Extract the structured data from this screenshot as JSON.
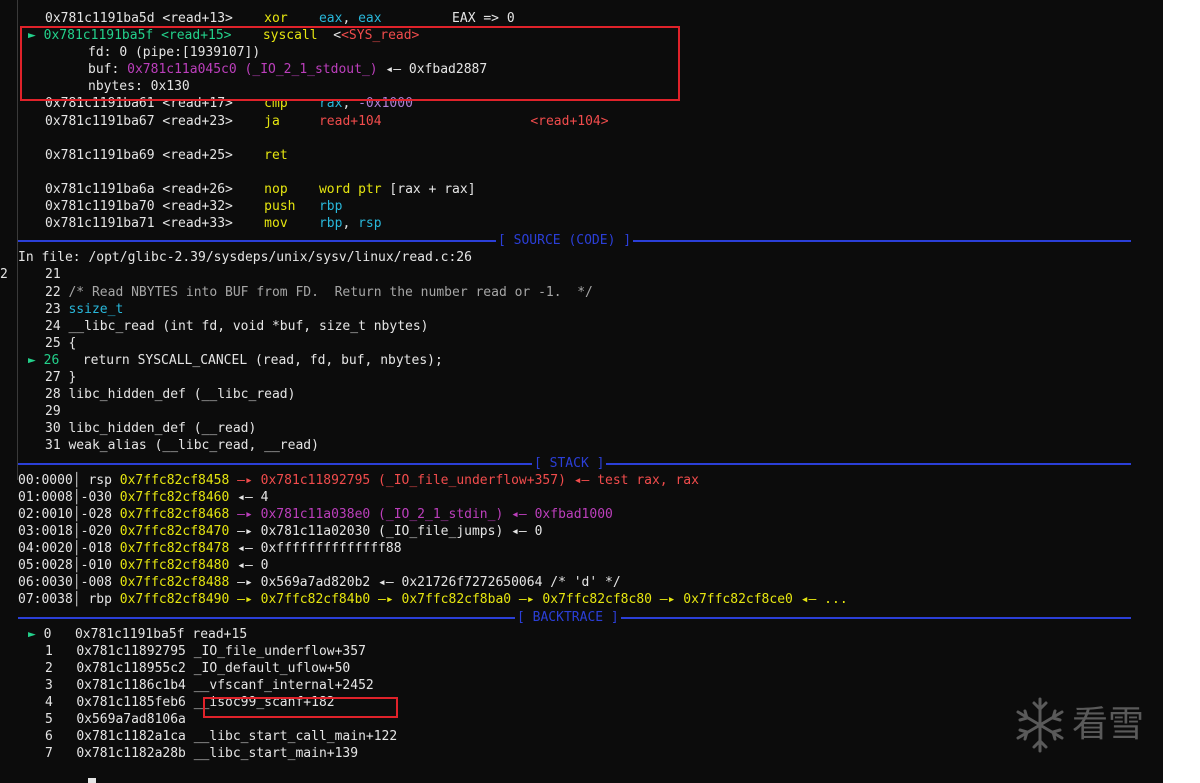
{
  "disasm": [
    {
      "addr": "0x781c1191ba5d",
      "off": "<read+13>",
      "mn": "xor",
      "op1": "eax",
      "sep": ", ",
      "op2": "eax",
      "cmt": "EAX => 0"
    },
    {
      "marker": "►",
      "addr": "0x781c1191ba5f",
      "off": "<read+15>",
      "mn": "syscall",
      "target": "<SYS_read>"
    },
    {
      "addr": "0x781c1191ba61",
      "off": "<read+17>",
      "mn": "cmp",
      "op1": "rax",
      "sep": ", ",
      "op2": "-0x1000"
    },
    {
      "addr": "0x781c1191ba67",
      "off": "<read+23>",
      "mn": "ja",
      "op1": "read+104",
      "cmt": "<read+104>"
    },
    {
      "addr": "0x781c1191ba69",
      "off": "<read+25>",
      "mn": "ret"
    },
    {
      "addr": "0x781c1191ba6a",
      "off": "<read+26>",
      "mn": "nop",
      "op1": "word ptr",
      "op2": "[rax + rax]"
    },
    {
      "addr": "0x781c1191ba70",
      "off": "<read+32>",
      "mn": "push",
      "op1": "rbp"
    },
    {
      "addr": "0x781c1191ba71",
      "off": "<read+33>",
      "mn": "mov",
      "op1": "rbp",
      "sep": ", ",
      "op2": "rsp"
    }
  ],
  "syscall_args": {
    "fd_label": "fd:",
    "fd_value": "0 (pipe:[1939107])",
    "buf_label": "buf:",
    "buf_value": "0x781c11a045c0 (_IO_2_1_stdout_)",
    "buf_arrow": "◂— 0xfbad2887",
    "nbytes_label": "nbytes:",
    "nbytes_value": "0x130"
  },
  "source": {
    "header": "[ SOURCE (CODE) ]",
    "file": "In file: /opt/glibc-2.39/sysdeps/unix/sysv/linux/read.c:26",
    "edge_char": "2",
    "lines": [
      {
        "n": "21",
        "t": ""
      },
      {
        "n": "22",
        "t": "/* Read NBYTES into BUF from FD.  Return the number read or -1.  */"
      },
      {
        "n": "23",
        "t": "ssize_t"
      },
      {
        "n": "24",
        "t": "__libc_read (int fd, void *buf, size_t nbytes)"
      },
      {
        "n": "25",
        "t": "{"
      },
      {
        "n": "26",
        "marker": "►",
        "t": "  return SYSCALL_CANCEL (read, fd, buf, nbytes);"
      },
      {
        "n": "27",
        "t": "}"
      },
      {
        "n": "28",
        "t": "libc_hidden_def (__libc_read)"
      },
      {
        "n": "29",
        "t": ""
      },
      {
        "n": "30",
        "t": "libc_hidden_def (__read)"
      },
      {
        "n": "31",
        "t": "weak_alias (__libc_read, __read)"
      }
    ]
  },
  "stack": {
    "header": "[ STACK ]",
    "rows": [
      {
        "idx": "00:0000",
        "reg": "rsp",
        "addr": "0x7ffc82cf8458",
        "rest": "—▸ 0x781c11892795 (_IO_file_underflow+357) ◂— test rax, rax"
      },
      {
        "idx": "01:0008",
        "reg": "-030",
        "addr": "0x7ffc82cf8460",
        "rest": "◂— 4"
      },
      {
        "idx": "02:0010",
        "reg": "-028",
        "addr": "0x7ffc82cf8468",
        "rest": "—▸ 0x781c11a038e0 (_IO_2_1_stdin_) ◂— 0xfbad1000"
      },
      {
        "idx": "03:0018",
        "reg": "-020",
        "addr": "0x7ffc82cf8470",
        "rest": "—▸ 0x781c11a02030 (_IO_file_jumps) ◂— 0"
      },
      {
        "idx": "04:0020",
        "reg": "-018",
        "addr": "0x7ffc82cf8478",
        "rest": "◂— 0xffffffffffffff88"
      },
      {
        "idx": "05:0028",
        "reg": "-010",
        "addr": "0x7ffc82cf8480",
        "rest": "◂— 0"
      },
      {
        "idx": "06:0030",
        "reg": "-008",
        "addr": "0x7ffc82cf8488",
        "rest": "—▸ 0x569a7ad820b2 ◂— 0x21726f7272650064 /* 'd' */"
      },
      {
        "idx": "07:0038",
        "reg": "rbp",
        "addr": "0x7ffc82cf8490",
        "rest": "—▸ 0x7ffc82cf84b0 —▸ 0x7ffc82cf8ba0 —▸ 0x7ffc82cf8c80 —▸ 0x7ffc82cf8ce0 ◂— ..."
      }
    ]
  },
  "backtrace": {
    "header": "[ BACKTRACE ]",
    "frames": [
      {
        "marker": "►",
        "n": "0",
        "addr": "0x781c1191ba5f",
        "sym": "read+15"
      },
      {
        "n": "1",
        "addr": "0x781c11892795",
        "sym": "_IO_file_underflow+357"
      },
      {
        "n": "2",
        "addr": "0x781c118955c2",
        "sym": "_IO_default_uflow+50"
      },
      {
        "n": "3",
        "addr": "0x781c1186c1b4",
        "sym": "__vfscanf_internal+2452"
      },
      {
        "n": "4",
        "addr": "0x781c1185feb6",
        "sym": "__isoc99_scanf+182"
      },
      {
        "n": "5",
        "addr": "0x569a7ad8106a",
        "sym": ""
      },
      {
        "n": "6",
        "addr": "0x781c1182a1ca",
        "sym": "__libc_start_call_main+122"
      },
      {
        "n": "7",
        "addr": "0x781c1182a28b",
        "sym": "__libc_start_main+139"
      }
    ]
  },
  "watermark": "看雪",
  "colors": {
    "accent_blue": "#2b3fd8",
    "highlight_red": "#e0222a",
    "green": "#23d18b",
    "yellow": "#e5e510"
  }
}
